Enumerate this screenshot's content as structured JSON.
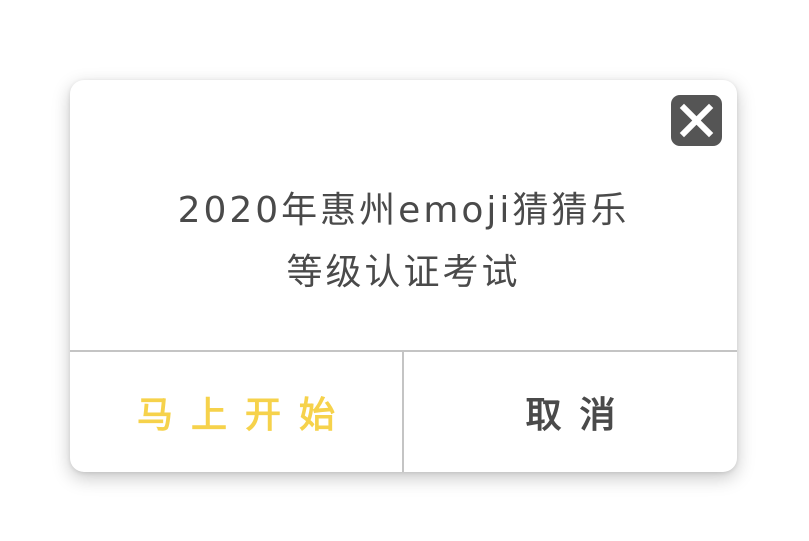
{
  "dialog": {
    "message_line1": "2020年惠州emoji猜猜乐",
    "message_line2": "等级认证考试",
    "start_label": "马上开始",
    "cancel_label": "取消",
    "close_icon": "close-icon"
  },
  "colors": {
    "accent": "#f6d24b",
    "text": "#4a4a4a",
    "close_bg": "#555555",
    "divider": "#c4c4c4"
  }
}
